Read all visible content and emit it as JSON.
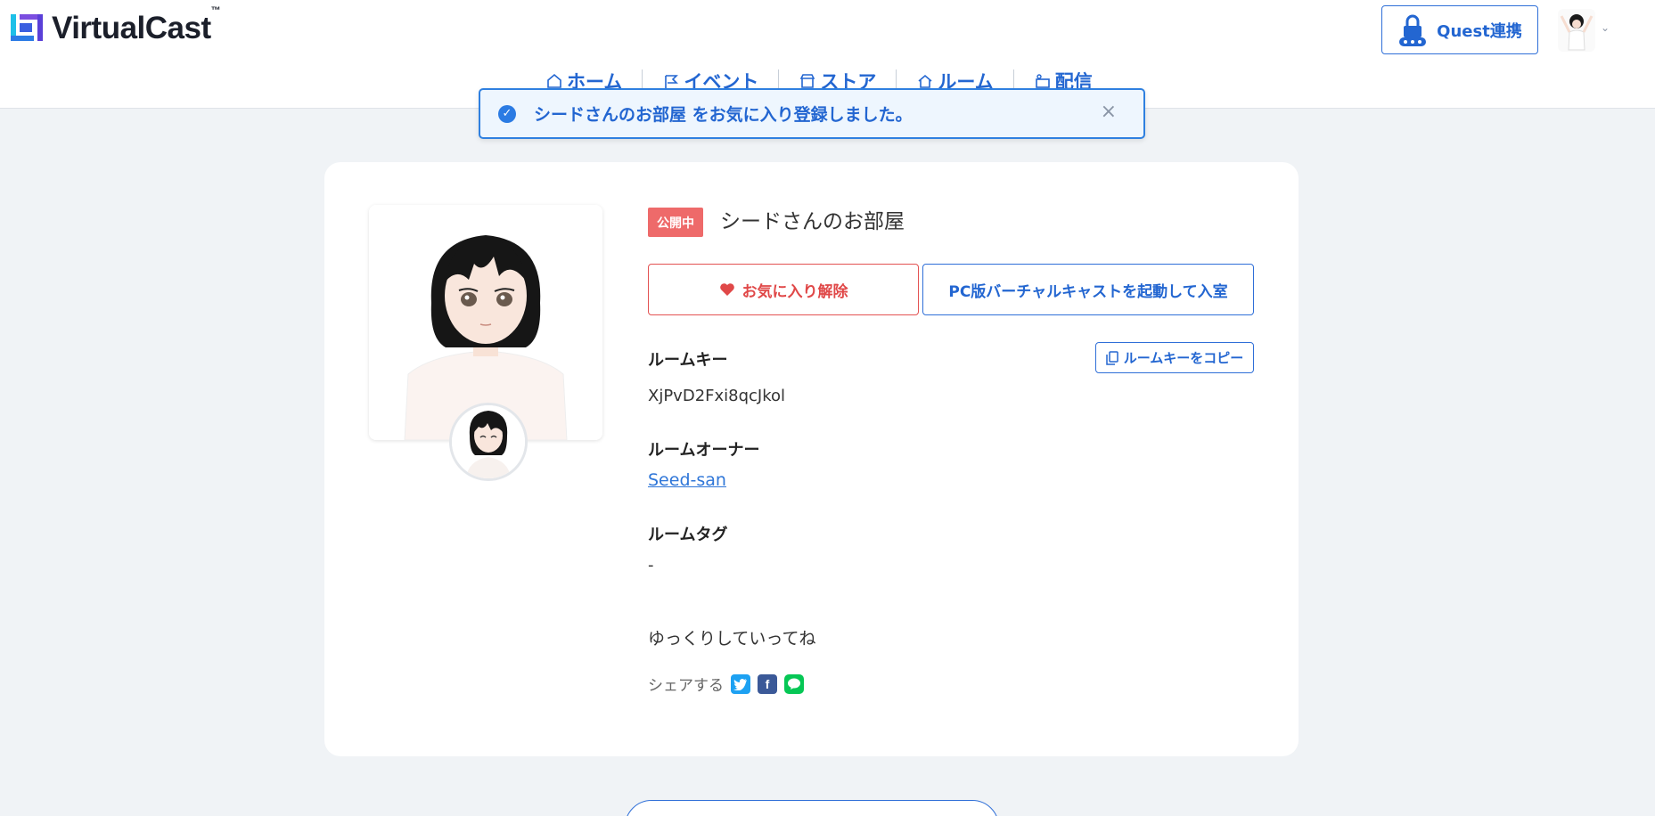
{
  "header": {
    "logo_text": "VirtualCast",
    "logo_tm": "™",
    "quest_button": "Quest連携",
    "nav": [
      {
        "label": "ホーム",
        "icon": "home-icon"
      },
      {
        "label": "イベント",
        "icon": "flag-icon"
      },
      {
        "label": "ストア",
        "icon": "store-icon"
      },
      {
        "label": "ルーム",
        "icon": "room-icon"
      },
      {
        "label": "配信",
        "icon": "broadcast-icon"
      }
    ]
  },
  "toast": {
    "message": "シードさんのお部屋 をお気に入り登録しました。",
    "close": "×"
  },
  "room": {
    "status": "公開中",
    "title": "シードさんのお部屋",
    "unfavorite_button": "お気に入り解除",
    "enter_button": "PC版バーチャルキャストを起動して入室",
    "room_key_label": "ルームキー",
    "room_key_value": "XjPvD2Fxi8qcJkol",
    "copy_button": "ルームキーをコピー",
    "owner_label": "ルームオーナー",
    "owner_name": "Seed-san",
    "tag_label": "ルームタグ",
    "tag_value": "-",
    "description": "ゆっくりしていってね",
    "share_label": "シェアする"
  },
  "colors": {
    "accent": "#2366d1",
    "danger": "#e04848",
    "badge": "#ee6a6a",
    "background": "#f0f3f6"
  }
}
